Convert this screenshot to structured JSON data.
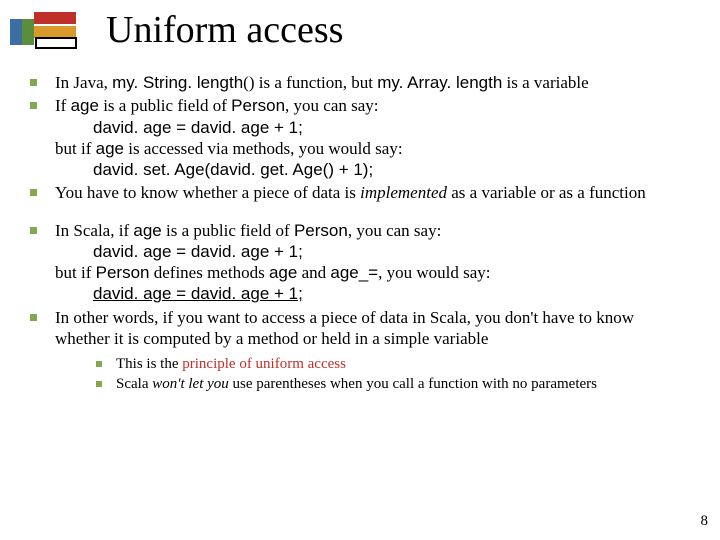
{
  "title": "Uniform access",
  "page_number": "8",
  "b1": {
    "pre": "In Java, ",
    "code1": "my. String. length",
    "mid1": "() is a function, but ",
    "code2": "my. Array. length",
    "post": " is a variable"
  },
  "b2": {
    "l1_a": "If ",
    "l1_b": "age",
    "l1_c": " is a public field of ",
    "l1_d": "Person",
    "l1_e": ", you can say:",
    "l2": "david. age = david. age + 1;",
    "l3_a": "but if ",
    "l3_b": "age",
    "l3_c": " is accessed via methods, you would say:",
    "l4": "david. set. Age(david. get. Age() + 1);"
  },
  "b3": {
    "a": "You have to know whether a piece of data is ",
    "b": "implemented",
    "c": " as a variable or as a function"
  },
  "b4": {
    "l1_a": "In Scala, if ",
    "l1_b": "age",
    "l1_c": " is a public field of ",
    "l1_d": "Person",
    "l1_e": ", you can say:",
    "l2": "david. age = david. age + 1;",
    "l3_a": "but if ",
    "l3_b": "Person",
    "l3_c": " defines methods ",
    "l3_d": "age",
    "l3_e": " and ",
    "l3_f": "age_=",
    "l3_g": ", you would say:",
    "l4": "david. age = david. age + 1;"
  },
  "b5": "In other words, if you want to access a piece of data in Scala, you don't have to know whether it is computed by a method or held in a simple variable",
  "sub1": {
    "a": "This is the ",
    "b": "principle of uniform access"
  },
  "sub2": {
    "a": "Scala ",
    "b": "won't let you",
    "c": " use parentheses when you call a function with no parameters"
  }
}
